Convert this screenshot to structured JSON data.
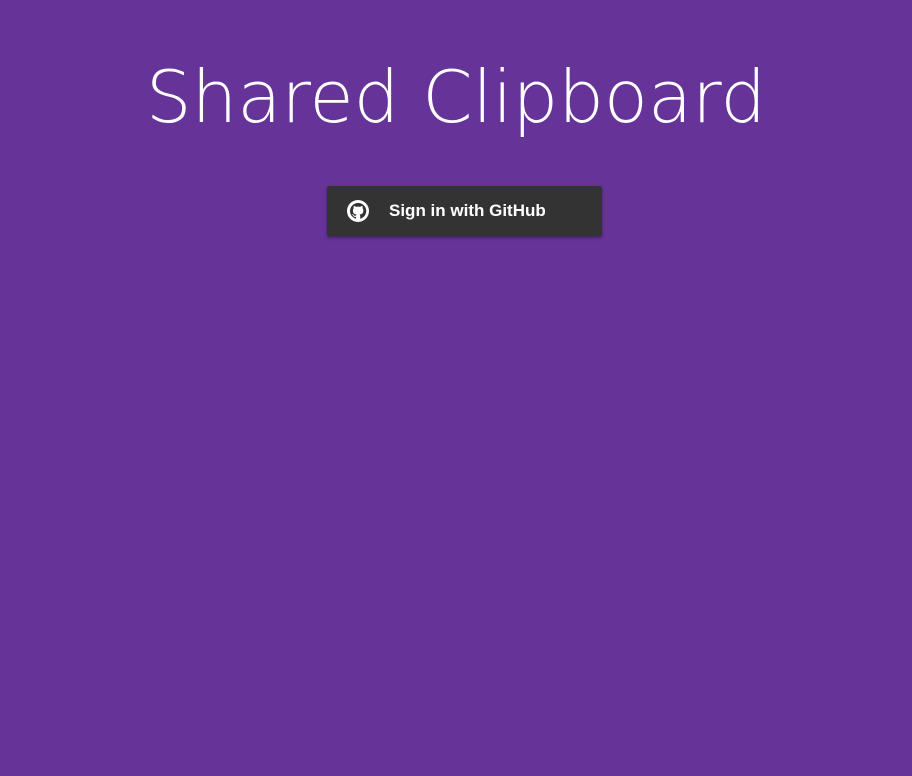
{
  "page": {
    "title": "Shared Clipboard",
    "background_color": "#663399"
  },
  "signin": {
    "label": "Sign in with GitHub",
    "icon": "github-icon",
    "button_color": "#333333",
    "text_color": "#ffffff"
  }
}
